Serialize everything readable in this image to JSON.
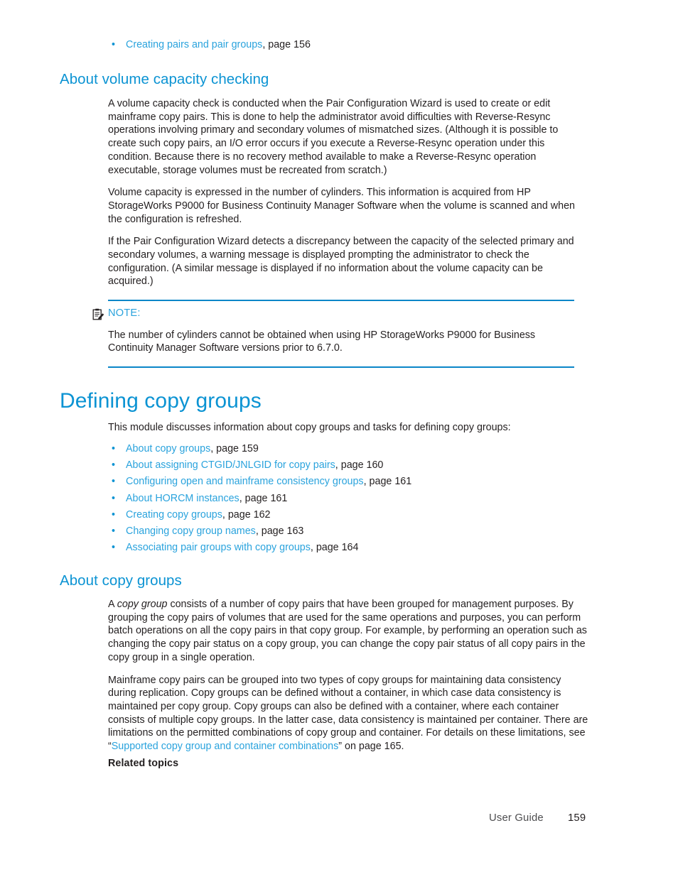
{
  "document": {
    "type": "user-guide-page",
    "accent_color": "#0b93d3",
    "link_color": "#2aa3dd",
    "text_color": "#231f20"
  },
  "top_list": {
    "bullet_glyph": "•",
    "items": [
      {
        "link": "Creating pairs and pair groups",
        "page_label": ", page 156"
      }
    ]
  },
  "section_volume_capacity": {
    "heading": "About volume capacity checking",
    "paragraphs": [
      "A volume capacity check is conducted when the Pair Configuration Wizard is used to create or edit mainframe copy pairs. This is done to help the administrator avoid difficulties with Reverse-Resync operations involving primary and secondary volumes of mismatched sizes. (Although it is possible to create such copy pairs, an I/O error occurs if you execute a Reverse-Resync operation under this condition. Because there is no recovery method available to make a Reverse-Resync operation executable, storage volumes must be recreated from scratch.)",
      "Volume capacity is expressed in the number of cylinders. This information is acquired from HP StorageWorks P9000 for Business Continuity Manager Software when the volume is scanned and when the configuration is refreshed.",
      "If the Pair Configuration Wizard detects a discrepancy between the capacity of the selected primary and secondary volumes, a warning message is displayed prompting the administrator to check the configuration. (A similar message is displayed if no information about the volume capacity can be acquired.)"
    ]
  },
  "note": {
    "icon": "note-clipboard-icon",
    "label": "NOTE:",
    "text": "The number of cylinders cannot be obtained when using HP StorageWorks P9000 for Business Continuity Manager Software versions prior to 6.7.0."
  },
  "chapter": {
    "heading": "Defining copy groups",
    "intro": "This module discusses information about copy groups and tasks for defining copy groups:",
    "bullet_glyph": "•",
    "links": [
      {
        "link": "About copy groups",
        "page_label": ", page 159"
      },
      {
        "link": "About assigning CTGID/JNLGID for copy pairs",
        "page_label": ", page 160"
      },
      {
        "link": "Configuring open and mainframe consistency groups",
        "page_label": ", page 161"
      },
      {
        "link": "About HORCM instances",
        "page_label": ", page 161"
      },
      {
        "link": "Creating copy groups",
        "page_label": ", page 162"
      },
      {
        "link": "Changing copy group names",
        "page_label": ", page 163"
      },
      {
        "link": "Associating pair groups with copy groups",
        "page_label": ", page 164"
      }
    ]
  },
  "section_about_copy_groups": {
    "heading": "About copy groups",
    "para1": {
      "prefix": "A ",
      "term": "copy group",
      "rest": " consists of a number of copy pairs that have been grouped for management purposes. By grouping the copy pairs of volumes that are used for the same operations and purposes, you can perform batch operations on all the copy pairs in that copy group. For example, by performing an operation such as changing the copy pair status on a copy group, you can change  the copy pair status of all copy pairs in the copy group in a single operation."
    },
    "para2": {
      "prefix": "Mainframe copy pairs can be grouped into two types of copy groups for maintaining data consistency during replication. Copy groups can be defined without a container, in which case data consistency is maintained per copy group. Copy groups can also be defined with a container, where each container consists of multiple copy groups. In the latter case, data consistency is maintained per container. There are limitations on the permitted combinations of copy group and container. For details on these limitations, see “",
      "link": "Supported copy group and container combinations",
      "suffix": "” on page 165."
    },
    "related_topics_label": "Related topics"
  },
  "footer": {
    "guide_label": "User Guide",
    "page_number": "159"
  }
}
